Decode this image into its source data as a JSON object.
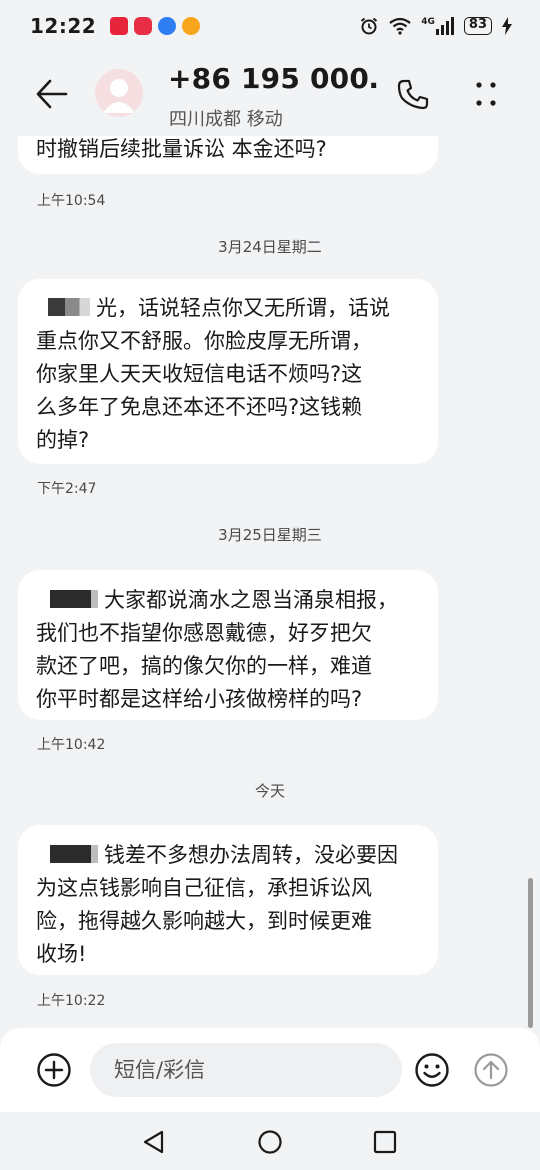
{
  "status_bar": {
    "time": "12:22",
    "network": "4G",
    "battery": "83",
    "notification_icons": [
      "huawei-icon",
      "app-icon",
      "bulb-icon",
      "weibo-icon"
    ],
    "system_icons": [
      "alarm-icon",
      "wifi-icon",
      "signal-icon",
      "battery-icon",
      "charging-icon"
    ]
  },
  "header": {
    "contact_name": "+86 195 000…",
    "contact_location": "四川成都 移动",
    "icons": [
      "back-arrow-icon",
      "avatar-icon",
      "phone-icon",
      "more-vertical-icon"
    ]
  },
  "messages": [
    {
      "text": "时撤销后续批量诉讼 本金还吗?",
      "time": "上午10:54"
    },
    {
      "date": "3月24日星期二",
      "prefix_visible": "光，",
      "text": "话说轻点你又无所谓，话说\n重点你又不舒服。你脸皮厚无所谓，\n你家里人天天收短信电话不烦吗?这\n么多年了免息还本还不还吗?这钱赖\n的掉?",
      "time": "下午2:47"
    },
    {
      "date": "3月25日星期三",
      "prefix_visible": "大家都说滴水之恩当涌泉相报，",
      "text": "\n我们也不指望你感恩戴德，好歹把欠\n款还了吧，搞的像欠你的一样，难道\n你平时都是这样给小孩做榜样的吗?",
      "time": "上午10:42"
    },
    {
      "date": "今天",
      "prefix_visible": "钱差不多想办法周转，",
      "text": "没必要因\n为这点钱影响自己征信，承担诉讼风\n险，拖得越久影响越大，到时候更难\n收场!",
      "time": "上午10:22"
    }
  ],
  "input_bar": {
    "placeholder": "短信/彩信",
    "icons": [
      "add-circle-icon",
      "emoji-icon",
      "send-icon"
    ]
  },
  "nav_bar": {
    "icons": [
      "nav-back-icon",
      "nav-home-icon",
      "nav-recent-icon"
    ]
  },
  "colors": {
    "background": "#f1f3f5",
    "bubble": "#ffffff",
    "text": "#1a1a1a",
    "secondary_text": "#4a4a4a",
    "avatar": "#f6dfe0"
  }
}
